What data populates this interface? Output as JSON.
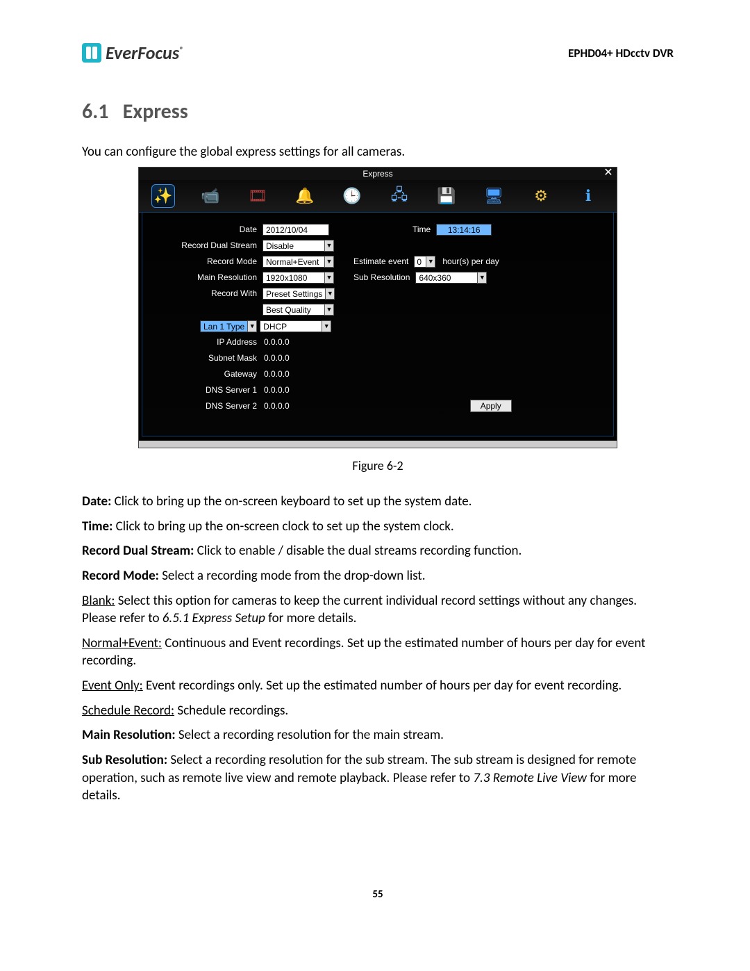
{
  "header": {
    "brand": "EverFocus",
    "reg": "®",
    "product": "EPHD04+  HDcctv DVR"
  },
  "section": {
    "number": "6.1",
    "title": "Express",
    "intro": "You can configure the global express settings for all cameras."
  },
  "dvr": {
    "title": "Express",
    "icons": [
      "sparkle",
      "camera",
      "film",
      "bell",
      "clock",
      "network",
      "disk",
      "monitor",
      "gears",
      "info"
    ],
    "fields": {
      "date_label": "Date",
      "date_value": "2012/10/04",
      "time_label": "Time",
      "time_value": "13:14:16",
      "dual_label": "Record Dual Stream",
      "dual_value": "Disable",
      "mode_label": "Record Mode",
      "mode_value": "Normal+Event",
      "est_label": "Estimate event",
      "est_value": "0",
      "est_suffix": "hour(s) per day",
      "mainres_label": "Main Resolution",
      "mainres_value": "1920x1080",
      "subres_label": "Sub Resolution",
      "subres_value": "640x360",
      "recwith_label": "Record With",
      "recwith_value": "Preset Settings",
      "recwith2_value": "Best Quality",
      "lan_label": "Lan 1 Type",
      "lan_value": "DHCP",
      "ip_label": "IP Address",
      "ip_value": "0.0.0.0",
      "mask_label": "Subnet Mask",
      "mask_value": "0.0.0.0",
      "gw_label": "Gateway",
      "gw_value": "0.0.0.0",
      "dns1_label": "DNS Server 1",
      "dns1_value": "0.0.0.0",
      "dns2_label": "DNS Server 2",
      "dns2_value": "0.0.0.0",
      "apply": "Apply"
    }
  },
  "figure_caption": "Figure 6-2",
  "descriptions": {
    "date_b": "Date: ",
    "date_t": "Click to bring up the on-screen keyboard to set up the system date.",
    "time_b": "Time: ",
    "time_t": "Click to bring up the on-screen clock to set up the system clock.",
    "dual_b": "Record Dual Stream: ",
    "dual_t": "Click to enable / disable the dual streams recording function.",
    "mode_b": "Record Mode: ",
    "mode_t": "Select a recording mode from the drop-down list.",
    "blank_u": "Blank:",
    "blank_t1": " Select this option for cameras to keep the current individual record settings without any changes. Please refer to ",
    "blank_i": "6.5.1 Express Setup",
    "blank_t2": " for more details.",
    "ne_u": "Normal+Event:",
    "ne_t": " Continuous and Event recordings. Set up the estimated number of hours per day for event recording.",
    "eo_u": "Event Only:",
    "eo_t": " Event recordings only. Set up the estimated number of hours per day for event recording.",
    "sr_u": "Schedule Record:",
    "sr_t": " Schedule recordings.",
    "mr_b": "Main Resolution: ",
    "mr_t": "Select a recording resolution for the main stream.",
    "sub_b": "Sub Resolution: ",
    "sub_t1": "Select a recording resolution for the sub stream. The sub stream is designed for remote operation, such as remote live view and remote playback. Please refer to ",
    "sub_i": "7.3 Remote Live View",
    "sub_t2": " for more details."
  },
  "page_number": "55"
}
